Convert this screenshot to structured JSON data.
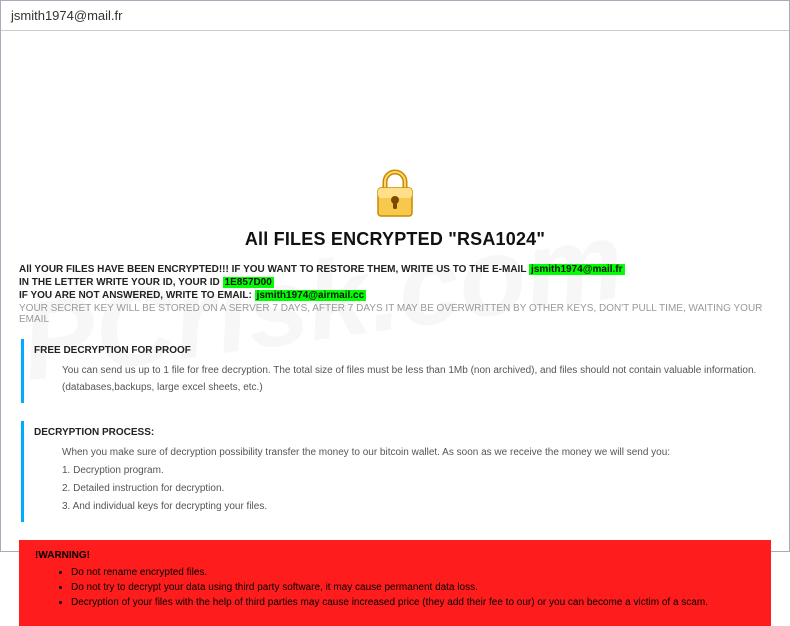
{
  "titlebar": {
    "text": "jsmith1974@mail.fr"
  },
  "heading": "All FILES ENCRYPTED \"RSA1024\"",
  "lines": {
    "l1_pre": "All YOUR FILES HAVE BEEN ENCRYPTED!!! IF YOU WANT TO RESTORE THEM, WRITE US TO THE E-MAIL ",
    "l1_hl": "jsmith1974@mail.fr",
    "l2_pre": "IN THE LETTER WRITE YOUR ID, YOUR ID ",
    "l2_hl": "1E857D00",
    "l3_pre": "IF YOU ARE NOT ANSWERED, WRITE TO EMAIL: ",
    "l3_hl": "jsmith1974@airmail.cc",
    "l4": "YOUR SECRET KEY WILL BE STORED ON A SERVER 7 DAYS, AFTER 7 DAYS IT MAY BE OVERWRITTEN BY OTHER KEYS, DON'T PULL TIME, WAITING YOUR EMAIL"
  },
  "proof": {
    "title": "FREE DECRYPTION FOR PROOF",
    "body": "You can send us up to 1 file for free decryption. The total size of files must be less than 1Mb (non archived), and files should not contain valuable information. (databases,backups, large excel sheets, etc.)"
  },
  "process": {
    "title": "DECRYPTION PROCESS:",
    "intro": "When you make sure of decryption possibility transfer the money to our bitcoin wallet. As soon as we receive the money we will send you:",
    "s1": "1. Decryption program.",
    "s2": "2. Detailed instruction for decryption.",
    "s3": "3. And individual keys for decrypting your files."
  },
  "warning": {
    "title": "!WARNING!",
    "w1": "Do not rename encrypted files.",
    "w2": "Do not try to decrypt your data using third party software, it may cause permanent data loss.",
    "w3": "Decryption of your files with the help of third parties may cause increased price (they add their fee to our) or you can become a victim of a scam."
  },
  "watermark": "PCrisk.com"
}
